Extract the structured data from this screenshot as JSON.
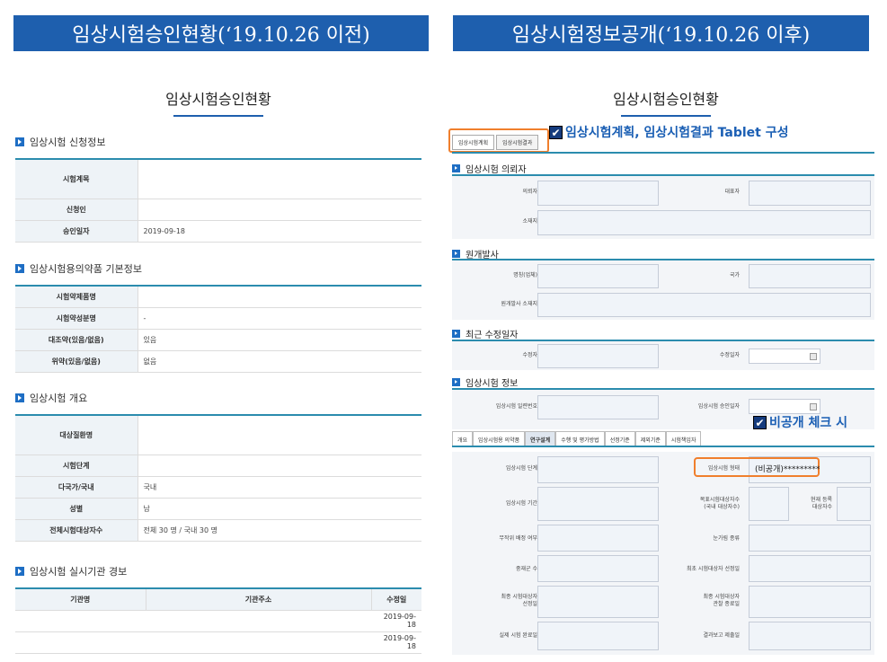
{
  "left_banner": "임상시험승인현황(‘19.10.26 이전)",
  "right_banner": "임상시험정보공개(‘19.10.26 이후)",
  "left_page_title": "임상시험승인현황",
  "right_page_title": "임상시험승인현황",
  "left": {
    "sections": [
      "임상시험 신청정보",
      "임상시험용의약품 기본정보",
      "임상시험 개요",
      "임상시험 실시기관 경보"
    ],
    "apply": [
      {
        "label": "시험계목",
        "value": ""
      },
      {
        "label": "신청인",
        "value": ""
      },
      {
        "label": "승인일자",
        "value": "2019-09-18"
      }
    ],
    "drug": [
      {
        "label": "시험약제품명",
        "value": ""
      },
      {
        "label": "시험약성분명",
        "value": "-"
      },
      {
        "label": "대조약(있음/없음)",
        "value": "있음"
      },
      {
        "label": "위약(있음/없음)",
        "value": "없음"
      }
    ],
    "overview": [
      {
        "label": "대상질환명",
        "value": ""
      },
      {
        "label": "시험단계",
        "value": ""
      },
      {
        "label": "다국가/국내",
        "value": "국내"
      },
      {
        "label": "성별",
        "value": "남"
      },
      {
        "label": "전체시험대상자수",
        "value": "전체 30 명 / 국내 30 명"
      }
    ],
    "sites": {
      "headers": [
        "기관명",
        "기관주소",
        "수정일"
      ],
      "rows": [
        [
          "",
          "",
          "2019-09-18"
        ],
        [
          "",
          "",
          "2019-09-18"
        ]
      ]
    }
  },
  "right": {
    "top_tabs": [
      "임상시험계획",
      "임상시험결과"
    ],
    "callout_top": "임상시험계획, 임상시험결과 Tablet 구성",
    "callout_secret": "비공개 체크 시",
    "checkbox_glyph": "✔",
    "sections": [
      "임상시험 의뢰자",
      "원개발사",
      "최근 수정일자",
      "임상시험 정보"
    ],
    "sponsor_labels": [
      "의뢰자",
      "대표자",
      "소재지"
    ],
    "dev_labels": [
      "명칭(업체)",
      "국가",
      "원개발사 소재지"
    ],
    "update_labels": [
      "수정자",
      "수정일자"
    ],
    "info_labels": [
      "임상시험 일련번호",
      "임상시험 승인일자"
    ],
    "tabs": [
      "개요",
      "임상시험용 의약품",
      "연구설계",
      "수행 및 평가방법",
      "선정기준",
      "제외기준",
      "시험책임자"
    ],
    "design": {
      "l1": "임상시험 단계",
      "r1": "임상시험 형태",
      "secret_value": "(비공개)*********",
      "l2": "임상시험 기간",
      "r2a": "목표시험대상자수",
      "r2b": "(국내 대상자수)",
      "r2c": "현재 등록",
      "r2d": "대상자수",
      "l3": "무작위 배정 여부",
      "r3": "눈가림 종류",
      "l4": "중재군 수",
      "r4": "최초 시험대상자 선정일",
      "l5a": "최종 시험대상자",
      "l5b": "선정일",
      "r5a": "최종 시험대상자",
      "r5b": "관찰 종료일",
      "l6": "실제 시험 완료일",
      "r6": "결과보고 제출일"
    },
    "accent": "#1e5fae",
    "highlight": "#f07f2d"
  }
}
